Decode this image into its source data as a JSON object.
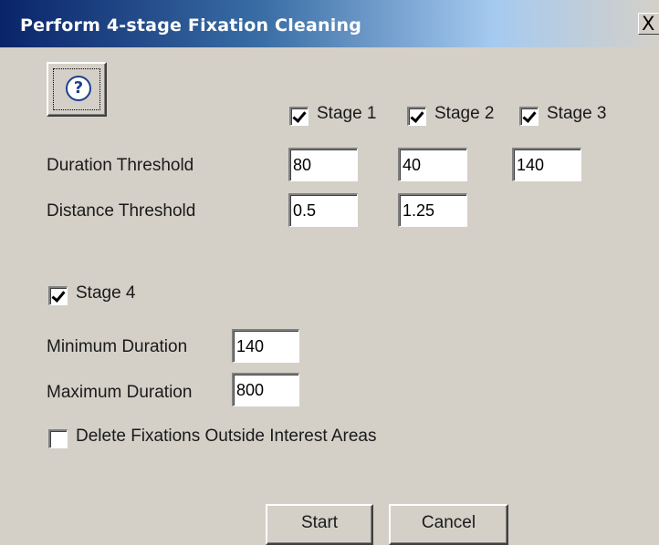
{
  "window": {
    "title": "Perform 4-stage Fixation Cleaning",
    "close_glyph": "X"
  },
  "help": {
    "icon": "question-mark-icon",
    "glyph": "?"
  },
  "stages": [
    {
      "label": "Stage 1",
      "checked": true
    },
    {
      "label": "Stage 2",
      "checked": true
    },
    {
      "label": "Stage 3",
      "checked": true
    }
  ],
  "duration_threshold": {
    "label": "Duration Threshold",
    "values": [
      "80",
      "40",
      "140"
    ]
  },
  "distance_threshold": {
    "label": "Distance Threshold",
    "values": [
      "0.5",
      "1.25"
    ]
  },
  "stage4": {
    "label": "Stage 4",
    "checked": true,
    "minimum_duration": {
      "label": "Minimum Duration",
      "value": "140"
    },
    "maximum_duration": {
      "label": "Maximum Duration",
      "value": "800"
    }
  },
  "delete_outside": {
    "label": "Delete Fixations Outside Interest Areas",
    "checked": false
  },
  "buttons": {
    "start": "Start",
    "cancel": "Cancel"
  }
}
